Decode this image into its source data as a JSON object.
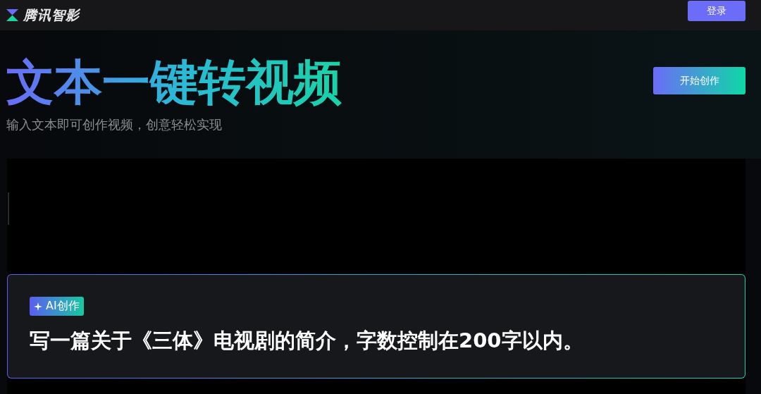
{
  "header": {
    "logo_text": "腾讯智影",
    "login_button": "登录"
  },
  "hero": {
    "title": "文本一键转视频",
    "subtitle": "输入文本即可创作视频，创意轻松实现",
    "start_button": "开始创作"
  },
  "prompt_card": {
    "badge": "AI创作",
    "text": "写一篇关于《三体》电视剧的简介，字数控制在200字以内。"
  }
}
